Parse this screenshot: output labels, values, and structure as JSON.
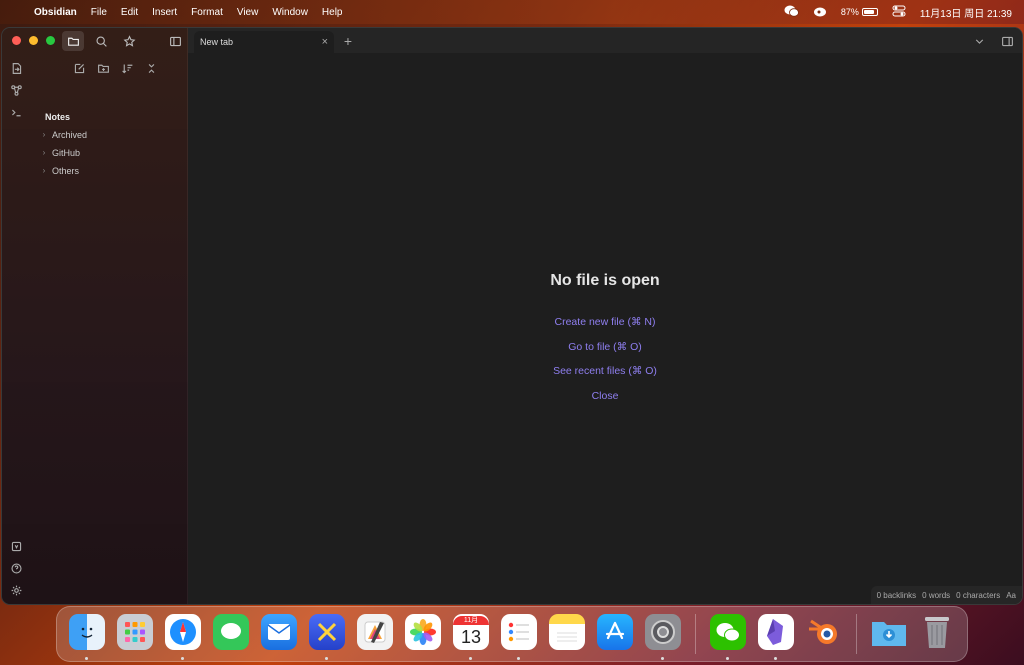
{
  "menubar": {
    "app_name": "Obsidian",
    "menus": [
      "File",
      "Edit",
      "Insert",
      "Format",
      "View",
      "Window",
      "Help"
    ],
    "battery_percent": "87%",
    "battery_level": 0.87,
    "datetime": "11月13日 周日 21:39"
  },
  "sidebar": {
    "vault_name": "Notes",
    "folders": [
      "Archived",
      "GitHub",
      "Others"
    ]
  },
  "tabs": {
    "active_title": "New tab"
  },
  "empty_state": {
    "title": "No file is open",
    "actions": [
      "Create new file (⌘ N)",
      "Go to file (⌘ O)",
      "See recent files (⌘ O)",
      "Close"
    ]
  },
  "statusbar": {
    "backlinks": "0 backlinks",
    "words": "0 words",
    "characters": "0 characters",
    "font_toggle": "Aa"
  },
  "dock": {
    "calendar_month": "11月",
    "calendar_day": "13"
  },
  "colors": {
    "accent": "#8f7ff0",
    "traffic_red": "#ff5f57",
    "traffic_yellow": "#febc2e",
    "traffic_green": "#28c840"
  }
}
